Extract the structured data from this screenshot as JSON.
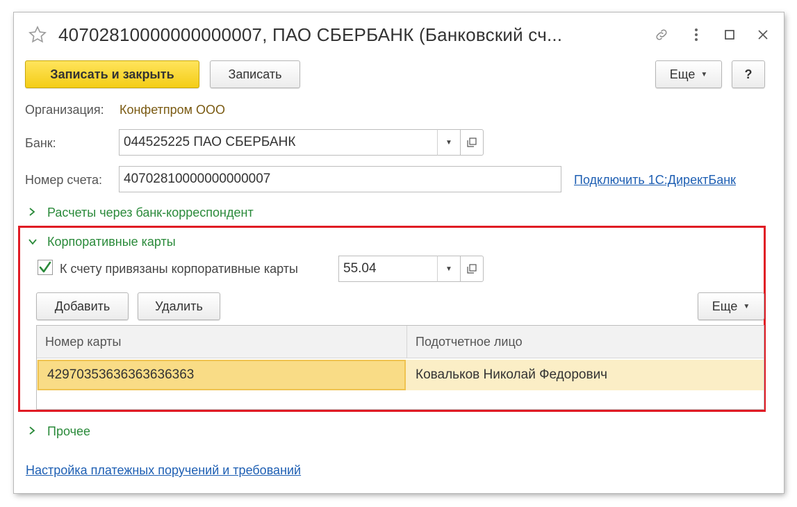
{
  "window": {
    "title": "40702810000000000007, ПАО СБЕРБАНК (Банковский сч..."
  },
  "toolbar": {
    "save_close_label": "Записать и закрыть",
    "save_label": "Записать",
    "more_label": "Еще",
    "help_label": "?"
  },
  "form": {
    "org_label": "Организация:",
    "org_value": "Конфетпром ООО",
    "bank_label": "Банк:",
    "bank_value": "044525225 ПАО СБЕРБАНК",
    "account_label": "Номер счета:",
    "account_value": "40702810000000000007",
    "directbank_link": "Подключить 1С:ДиректБанк"
  },
  "groups": {
    "correspondent": "Расчеты через банк-корреспондент",
    "corporate_cards": "Корпоративные карты",
    "other": "Прочее"
  },
  "cards": {
    "checkbox_label": "К счету привязаны корпоративные карты",
    "checkbox_checked": true,
    "account_value": "55.04",
    "add_label": "Добавить",
    "delete_label": "Удалить",
    "more_label": "Еще",
    "columns": [
      "Номер карты",
      "Подотчетное лицо"
    ],
    "rows": [
      [
        "42970353636363636363",
        "Ковальков Николай Федорович"
      ]
    ]
  },
  "footer": {
    "settings_link": "Настройка платежных поручений и требований"
  },
  "colors": {
    "primary_button": "#f4cd16",
    "highlight_frame": "#e01b24",
    "group_text": "#2a8a3a",
    "link": "#1e5fb3",
    "selected_row": "#fbeec6"
  }
}
